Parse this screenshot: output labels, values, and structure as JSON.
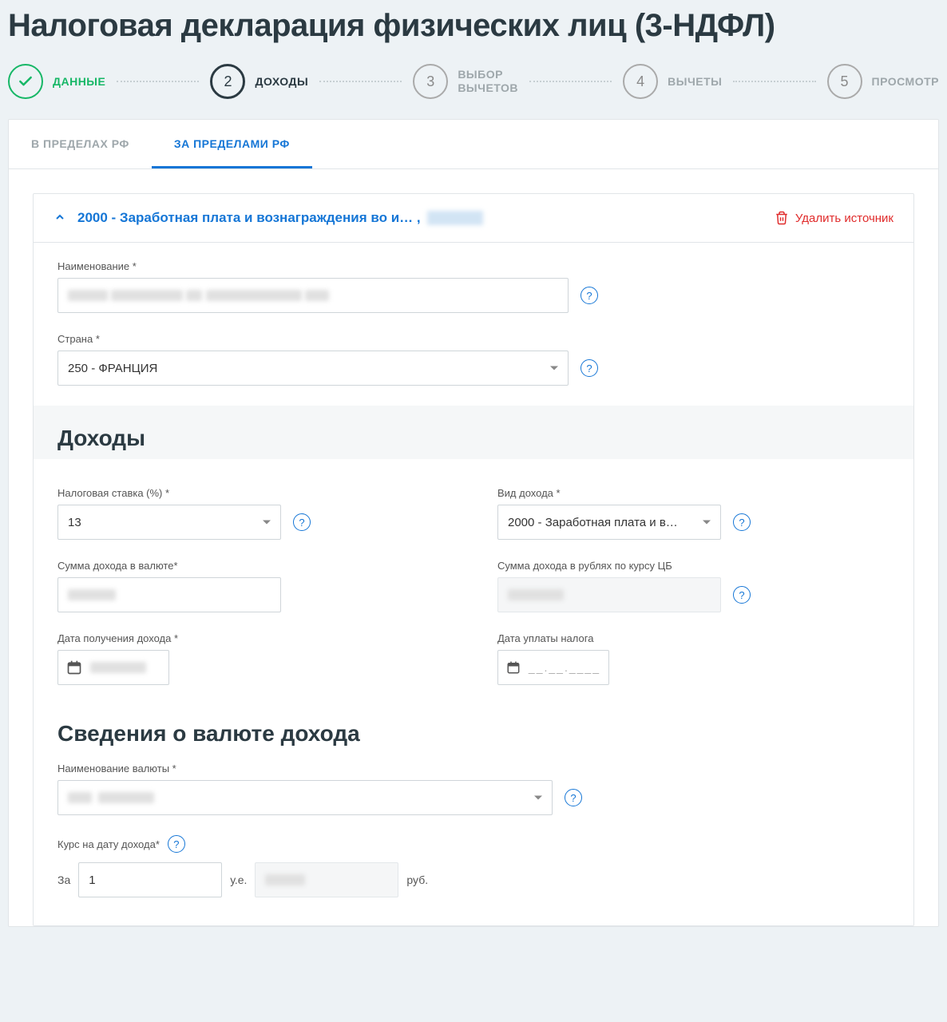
{
  "page_title": "Налоговая декларация физических лиц (3-НДФЛ)",
  "stepper": {
    "steps": [
      {
        "num": "",
        "label": "ДАННЫЕ",
        "state": "done"
      },
      {
        "num": "2",
        "label": "ДОХОДЫ",
        "state": "active"
      },
      {
        "num": "3",
        "label": "ВЫБОР\nВЫЧЕТОВ",
        "state": ""
      },
      {
        "num": "4",
        "label": "ВЫЧЕТЫ",
        "state": ""
      },
      {
        "num": "5",
        "label": "ПРОСМОТР",
        "state": ""
      }
    ]
  },
  "tabs": {
    "within": "В ПРЕДЕЛАХ РФ",
    "outside": "ЗА ПРЕДЕЛАМИ РФ"
  },
  "source": {
    "title_prefix": "2000 - Заработная плата и вознаграждения во и… ,",
    "delete_label": "Удалить источник"
  },
  "fields": {
    "name_label": "Наименование *",
    "country_label": "Страна *",
    "country_value": "250 - ФРАНЦИЯ",
    "income_section": "Доходы",
    "tax_rate_label": "Налоговая ставка (%) *",
    "tax_rate_value": "13",
    "income_type_label": "Вид дохода *",
    "income_type_value": "2000 - Заработная плата и в…",
    "sum_currency_label": "Сумма дохода в валюте*",
    "sum_rub_label": "Сумма дохода в рублях по курсу ЦБ",
    "date_received_label": "Дата получения дохода *",
    "date_paid_label": "Дата уплаты налога",
    "date_paid_placeholder": "__.__.____",
    "currency_section": "Сведения о валюте дохода",
    "currency_name_label": "Наименование валюты *",
    "rate_on_date_label": "Курс на дату дохода*",
    "za_label": "За",
    "za_value": "1",
    "ue_label": "у.е.",
    "rub_label": "руб."
  }
}
